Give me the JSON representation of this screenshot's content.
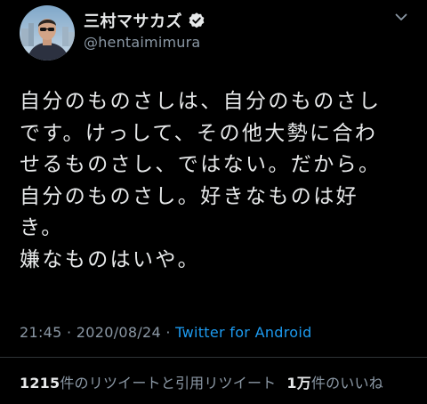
{
  "user": {
    "display_name": "三村マサカズ",
    "handle": "@hentaimimura",
    "verified": true
  },
  "tweet": {
    "text": "自分のものさしは、自分のものさし\nです。けっして、その他大勢に合わ\nせるものさし、ではない。だから。\n自分のものさし。好きなものは好\nき。\n嫌なものはいや。"
  },
  "meta": {
    "time": "21:45",
    "separator1": " · ",
    "date": "2020/08/24",
    "separator2": " · ",
    "source": "Twitter for Android"
  },
  "stats": {
    "retweets_count": "1215",
    "retweets_label": "件のリツイートと引用リツイート",
    "likes_count": "1万",
    "likes_label": "件のいいね"
  },
  "icons": {
    "verified": "verified-badge-icon",
    "more": "more-options-icon",
    "avatar": "avatar-photo"
  },
  "colors": {
    "background": "#000000",
    "text": "#e7e9ea",
    "secondary": "#8b98a5",
    "link": "#1d9bf0",
    "divider": "#2f3336"
  }
}
